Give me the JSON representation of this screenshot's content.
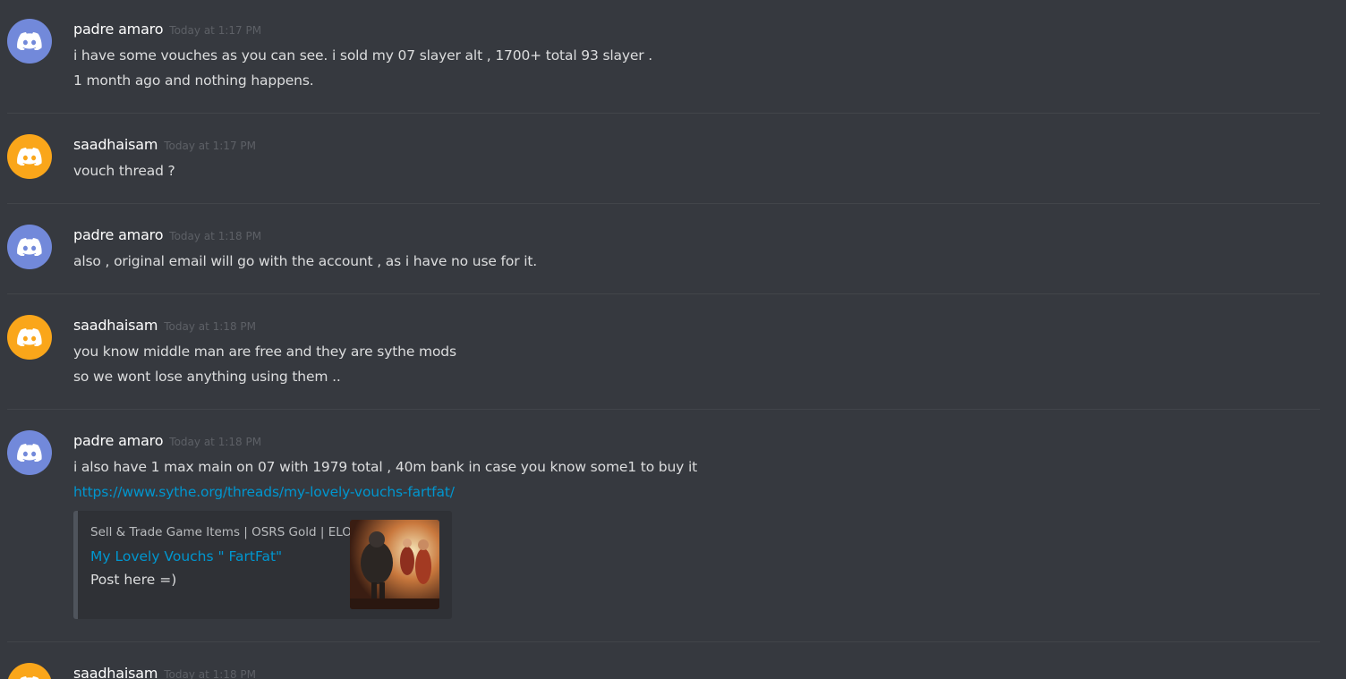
{
  "colors": {
    "background": "#36393f",
    "avatar_blue": "#7289da",
    "avatar_orange": "#faa61a",
    "link": "#0096cf"
  },
  "messages": [
    {
      "username": "padre amaro",
      "timestamp": "Today at 1:17 PM",
      "avatar_icon": "discord-logo-icon",
      "avatar_color": "blue",
      "lines": [
        "i have some vouches as you can see. i sold my 07 slayer alt , 1700+ total 93 slayer .",
        "1 month ago and nothing happens."
      ]
    },
    {
      "username": "saadhaisam",
      "timestamp": "Today at 1:17 PM",
      "avatar_icon": "discord-logo-icon",
      "avatar_color": "orange",
      "lines": [
        "vouch thread ?"
      ]
    },
    {
      "username": "padre amaro",
      "timestamp": "Today at 1:18 PM",
      "avatar_icon": "discord-logo-icon",
      "avatar_color": "blue",
      "lines": [
        "also , original email will go with the account , as i have no use for it."
      ]
    },
    {
      "username": "saadhaisam",
      "timestamp": "Today at 1:18 PM",
      "avatar_icon": "discord-logo-icon",
      "avatar_color": "orange",
      "lines": [
        "you know middle man are free and they are sythe mods",
        "so we wont lose anything using them .."
      ]
    },
    {
      "username": "padre amaro",
      "timestamp": "Today at 1:18 PM",
      "avatar_icon": "discord-logo-icon",
      "avatar_color": "blue",
      "lines": [
        "i also have 1 max main on 07 with 1979 total , 40m bank in case you know some1 to buy it"
      ],
      "link": "https://www.sythe.org/threads/my-lovely-vouchs-fartfat/",
      "embed": {
        "provider": "Sell & Trade Game Items | OSRS Gold | ELO",
        "title": "My Lovely Vouchs \" FartFat\"",
        "description": "Post here =)",
        "thumbnail_icon": "thread-thumbnail-image"
      }
    },
    {
      "username": "saadhaisam",
      "timestamp": "Today at 1:18 PM",
      "avatar_icon": "discord-logo-icon",
      "avatar_color": "orange",
      "lines": []
    }
  ]
}
